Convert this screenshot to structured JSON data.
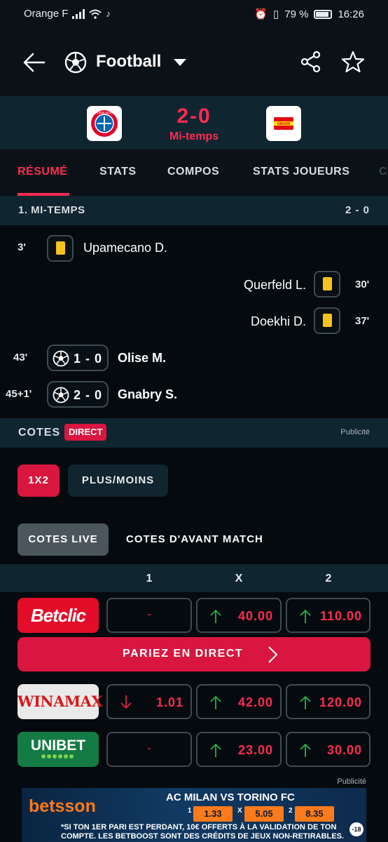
{
  "status_bar": {
    "carrier": "Orange F",
    "battery": "79 %",
    "time": "16:26"
  },
  "header": {
    "title": "Football"
  },
  "match": {
    "home_team_logo": "FC BAYERN MÜNCHEN",
    "away_team_logo": "UNION",
    "score": "2-0",
    "period": "Mi-temps"
  },
  "tabs": [
    "RÉSUMÉ",
    "STATS",
    "COMPOS",
    "STATS JOUEURS",
    "C"
  ],
  "active_tab": 0,
  "section": {
    "label": "1. MI-TEMPS",
    "score": "2 - 0"
  },
  "events": [
    {
      "minute": "3'",
      "type": "yellow-card",
      "side": "home",
      "player": "Upamecano D."
    },
    {
      "minute": "30'",
      "type": "yellow-card",
      "side": "away",
      "player": "Querfeld L."
    },
    {
      "minute": "37'",
      "type": "yellow-card",
      "side": "away",
      "player": "Doekhi D."
    },
    {
      "minute": "43'",
      "type": "goal",
      "side": "home",
      "score": "1 - 0",
      "player": "Olise M."
    },
    {
      "minute": "45+1'",
      "type": "goal",
      "side": "home",
      "score": "2 - 0",
      "player": "Gnabry S."
    }
  ],
  "cotes": {
    "label": "COTES",
    "badge": "DIRECT",
    "pub": "Publicité",
    "market_tabs": [
      "1X2",
      "PLUS/MOINS"
    ],
    "type_tabs": [
      "COTES LIVE",
      "COTES D'AVANT MATCH"
    ],
    "columns": [
      "1",
      "X",
      "2"
    ],
    "bookmakers": [
      {
        "name": "Betclic",
        "odds": [
          {
            "value": "-",
            "trend": "none"
          },
          {
            "value": "40.00",
            "trend": "up"
          },
          {
            "value": "110.00",
            "trend": "up"
          }
        ]
      },
      {
        "name": "WINAMAX",
        "odds": [
          {
            "value": "1.01",
            "trend": "down"
          },
          {
            "value": "42.00",
            "trend": "up"
          },
          {
            "value": "120.00",
            "trend": "up"
          }
        ]
      },
      {
        "name": "UNIBET",
        "odds": [
          {
            "value": "-",
            "trend": "none"
          },
          {
            "value": "23.00",
            "trend": "up"
          },
          {
            "value": "30.00",
            "trend": "up"
          }
        ]
      }
    ],
    "cta": "PARIEZ EN DIRECT"
  },
  "ad": {
    "pub": "Publicité",
    "brand": "betsson",
    "match": "AC MILAN VS TORINO FC",
    "odds": [
      {
        "label": "1",
        "value": "1.33"
      },
      {
        "label": "X",
        "value": "5.05"
      },
      {
        "label": "2",
        "value": "8.35"
      }
    ],
    "disclaimer": "*SI TON 1ER PARI EST PERDANT, 10€ OFFERTS À LA VALIDATION DE TON COMPTE. LES BETBOOST SONT DES CRÉDITS DE JEUX NON-RETIRABLES.",
    "age": "-18"
  },
  "colors": {
    "accent": "#ff2b52",
    "background": "#050a0e",
    "band": "#0f2530",
    "yellow_card": "#f6c21c",
    "up": "#22b24c",
    "down": "#e0223f"
  }
}
